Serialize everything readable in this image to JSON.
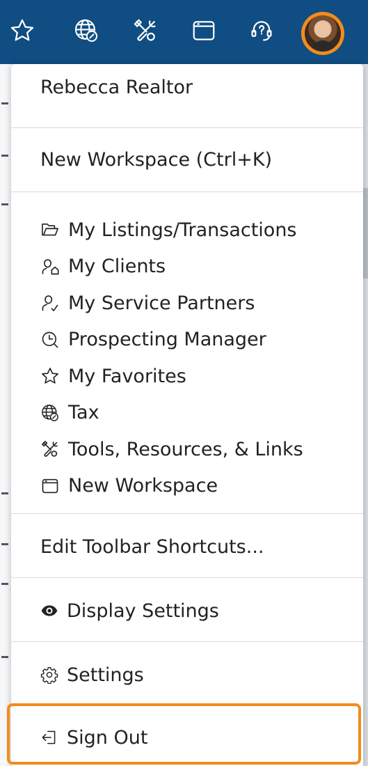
{
  "toolbar": {
    "icons": [
      "star-icon",
      "globe-tax-icon",
      "tools-icon",
      "workspace-window-icon",
      "help-headset-icon"
    ],
    "accent_color": "#f28c1c",
    "bar_color": "#0f4d82"
  },
  "menu": {
    "user_name": "Rebecca Realtor",
    "new_workspace_shortcut": "New Workspace (Ctrl+K)",
    "items": [
      {
        "label": "My Listings/Transactions",
        "icon": "folder-icon"
      },
      {
        "label": "My Clients",
        "icon": "clients-icon"
      },
      {
        "label": "My Service Partners",
        "icon": "service-partner-icon"
      },
      {
        "label": "Prospecting Manager",
        "icon": "search-clock-icon"
      },
      {
        "label": "My Favorites",
        "icon": "star-icon"
      },
      {
        "label": "Tax",
        "icon": "globe-tax-icon"
      },
      {
        "label": "Tools, Resources, & Links",
        "icon": "tools-icon"
      },
      {
        "label": "New Workspace",
        "icon": "workspace-window-icon"
      }
    ],
    "edit_toolbar": "Edit Toolbar Shortcuts...",
    "display_settings": "Display Settings",
    "settings": "Settings",
    "sign_out": "Sign Out"
  }
}
